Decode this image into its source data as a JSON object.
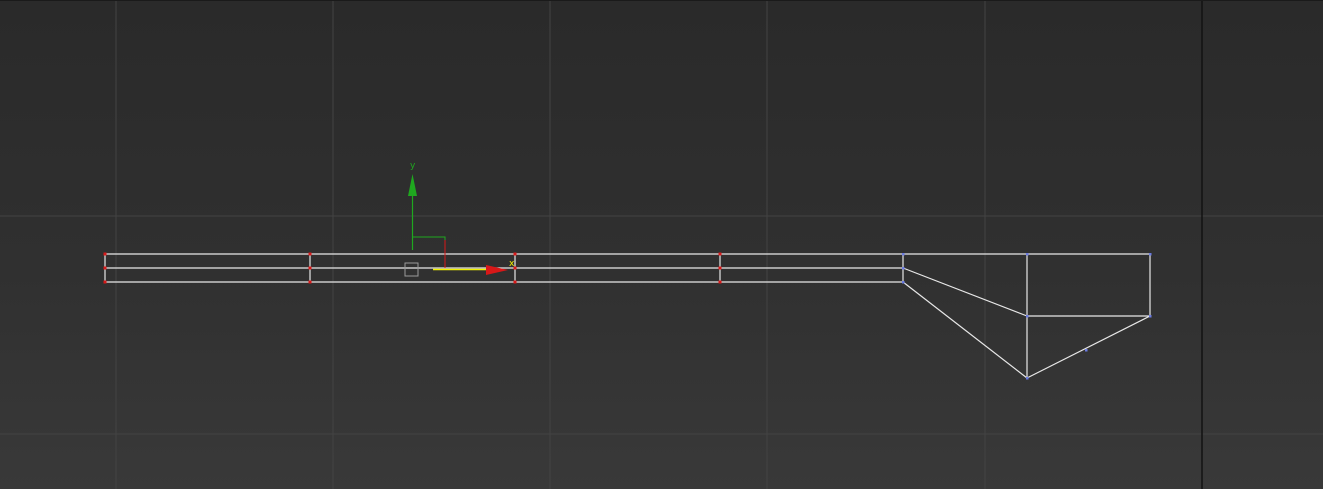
{
  "viewport": {
    "background_top": "#2a2a2a",
    "background_bottom": "#393939",
    "grid_color": "#434343",
    "border_color": "#121212"
  },
  "gizmo": {
    "y_label": "y",
    "x_label": "x",
    "y_color": "#1fa81f",
    "x_color": "#d81818",
    "plane_handle_color": "#f0f000"
  },
  "mesh": {
    "wire_color": "#e8e8e8",
    "selected_vertex_color": "#d81818",
    "vertex_color": "#6a7ae0"
  }
}
